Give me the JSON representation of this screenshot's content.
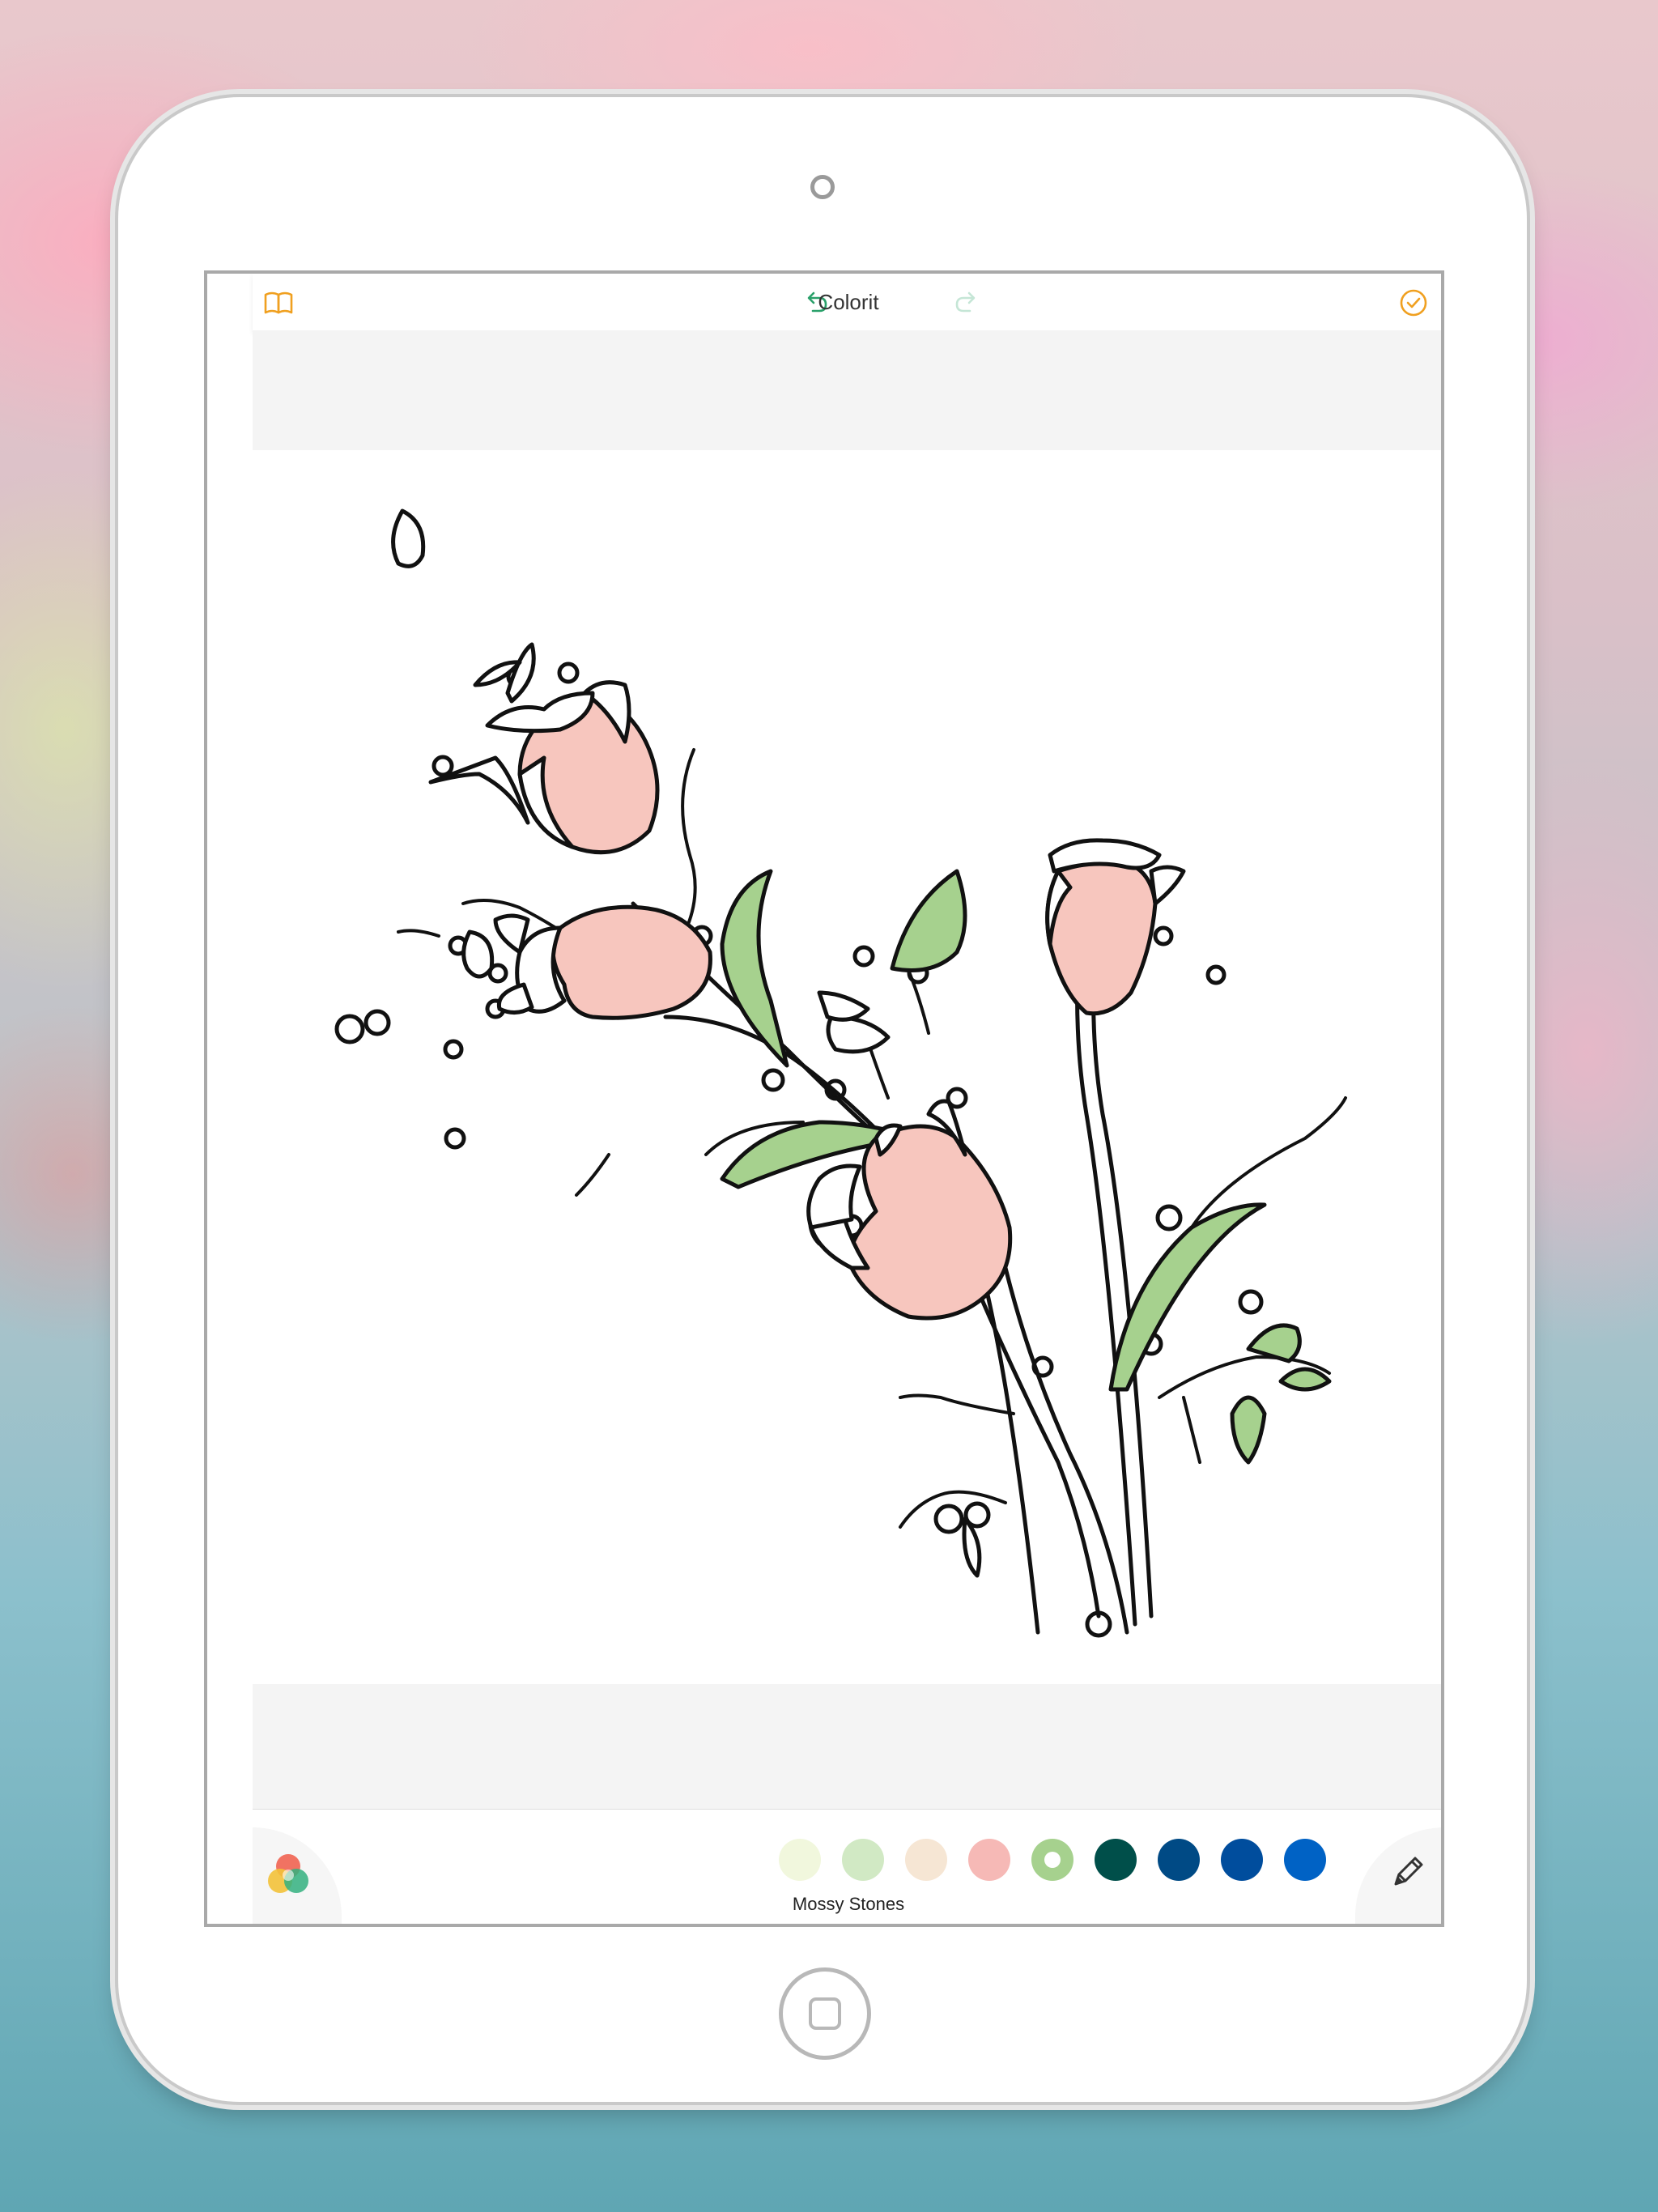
{
  "toolbar": {
    "title": "Colorit",
    "library_icon": "book-icon",
    "undo_icon": "undo-icon",
    "redo_icon": "redo-icon",
    "done_icon": "checkmark-circle-icon"
  },
  "palette": {
    "name": "Mossy Stones",
    "selected_index": 4,
    "colors": [
      "#f1f7dd",
      "#d1e9c4",
      "#f6e6d4",
      "#f6b9b6",
      "#a6d18e",
      "#004f4a",
      "#004a85",
      "#004d9d",
      "#0062c5"
    ]
  },
  "bottom": {
    "palette_icon": "color-palette-icon",
    "pencil_icon": "pencil-icon"
  },
  "artwork": {
    "subject": "tulip-bouquet",
    "fill_colors": {
      "petal": "#f7c6be",
      "leaf": "#a6d18e",
      "line": "#111111"
    }
  }
}
